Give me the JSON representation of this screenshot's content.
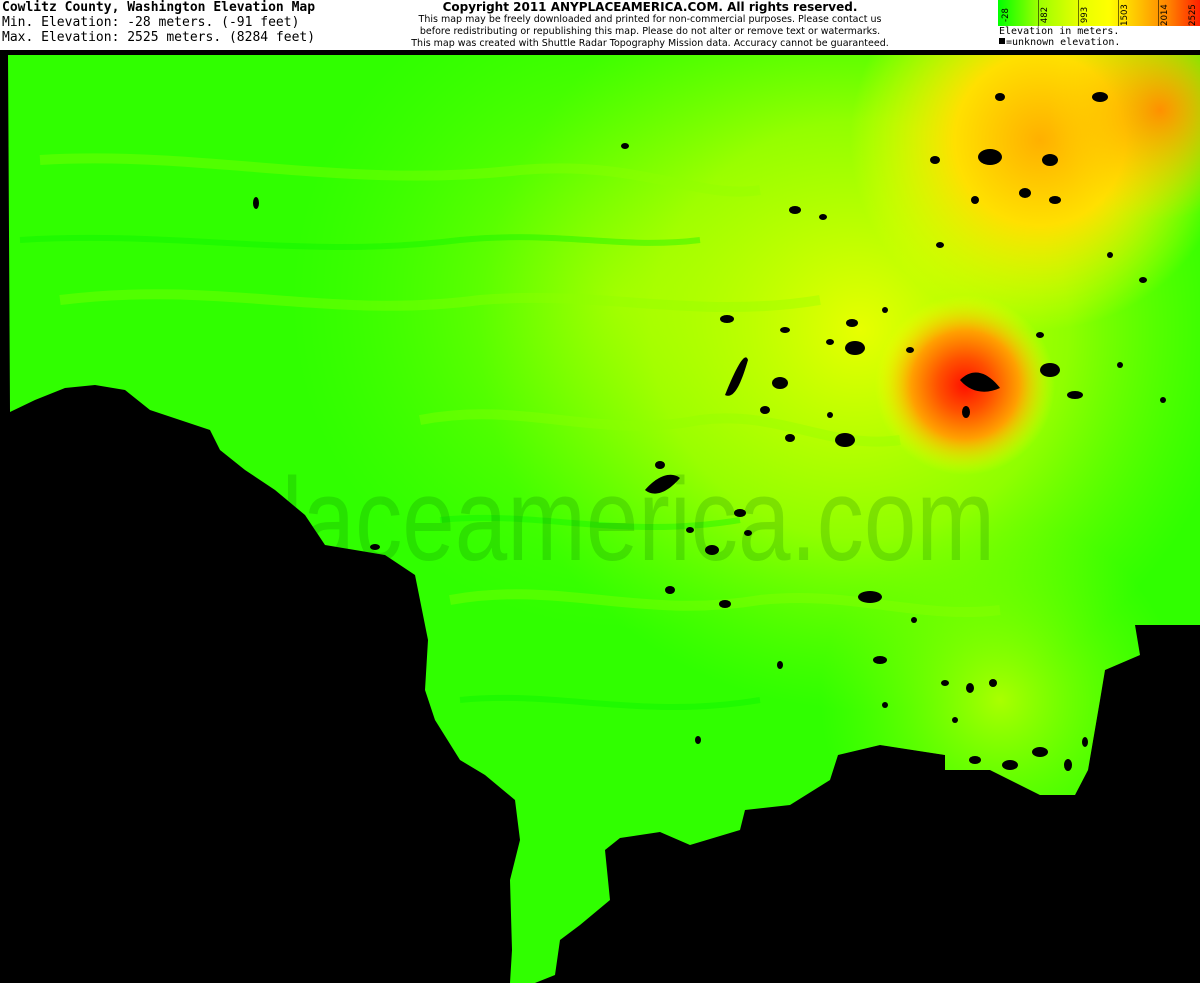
{
  "header": {
    "title": "Cowlitz County, Washington Elevation Map",
    "min_elevation": "Min. Elevation: -28 meters. (-91 feet)",
    "max_elevation": "Max. Elevation: 2525 meters. (8284 feet)"
  },
  "copyright": {
    "heading": "Copyright 2011 ANYPLACEAMERICA.COM.  All rights reserved.",
    "line1": "This map may be freely downloaded and printed for non-commercial purposes.  Please contact us",
    "line2": "before redistributing or republishing this map.  Please do not alter or remove text or watermarks.",
    "line3": "This map was created with Shuttle Radar Topography Mission data.  Accuracy cannot be guaranteed."
  },
  "legend": {
    "ticks": [
      "-28",
      "482",
      "993",
      "1503",
      "2014",
      "2525"
    ],
    "caption": "Elevation in meters.",
    "unknown": "=unknown elevation."
  },
  "watermark": "anyplaceamerica.com",
  "colors": {
    "low": "#00ff00",
    "mid": "#ffff00",
    "high": "#ff2000",
    "unknown": "#000000"
  }
}
